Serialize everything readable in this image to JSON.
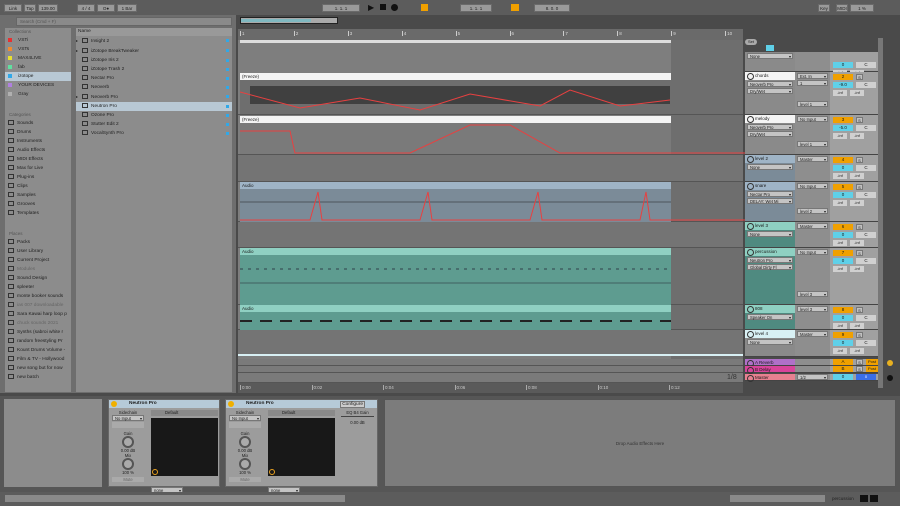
{
  "transport": {
    "link": "Link",
    "tap": "Tap",
    "tempo": "139.00",
    "signature": "4 / 4",
    "metronome": "O●",
    "quantize": "1 Bar",
    "position": "1.  1.  1",
    "position2": "1.  1.  1",
    "loop_length": "8.  0.  0",
    "key": "Key",
    "midi": "MIDI",
    "cpu": "1 %"
  },
  "browser": {
    "search_placeholder": "Search (Cmd + F)",
    "collections_header": "Collections",
    "collections": [
      {
        "label": "VSTi",
        "color": "#e83030"
      },
      {
        "label": "VSTs",
        "color": "#f08a30"
      },
      {
        "label": "MAX4LIVE",
        "color": "#e8e030"
      },
      {
        "label": "fab",
        "color": "#60e0a0"
      },
      {
        "label": "izotope",
        "color": "#30a8e8"
      },
      {
        "label": "YOUR DEVICES",
        "color": "#b080e0"
      },
      {
        "label": "Gray",
        "color": "#b0b0b0"
      }
    ],
    "categories_header": "Categories",
    "categories": [
      "Sounds",
      "Drums",
      "Instruments",
      "Audio Effects",
      "MIDI Effects",
      "Max for Live",
      "Plug-ins",
      "Clips",
      "Samples",
      "Grooves",
      "Templates"
    ],
    "places_header": "Places",
    "places": [
      "Packs",
      "User Library",
      "Current Project",
      "Modules",
      "Sound Design",
      "spleeter",
      "monte booker sounds",
      "ias 007 downloadable",
      "Sara Kawai harp loop p",
      "chuck sounds 2021",
      "Synths (sabroi white r",
      "random freestyling Pr",
      "Kount Drums Volume -",
      "Film & TV - Hollywood",
      "new song but for now",
      "new batch"
    ],
    "name_header": "Name",
    "files": [
      "Insight 2",
      "iZotope BreakTweaker",
      "iZotope Iris 2",
      "iZotope Trash 2",
      "Nectar Pro",
      "Neoverb",
      "Neoverb Pro",
      "Neutron Pro",
      "Ozone Pro",
      "Stutter Edit 2",
      "VocalSynth Pro"
    ]
  },
  "arrangement": {
    "bars": [
      "1",
      "2",
      "3",
      "4",
      "5",
      "6",
      "7",
      "8",
      "9",
      "10"
    ],
    "times": [
      "0:00",
      "0:02",
      "0:04",
      "0:06",
      "0:08",
      "0:10",
      "0:12"
    ],
    "zoom_label": "1/8",
    "freeze_label": "(Freeze)",
    "audio_label": "Audio"
  },
  "set_label": "Set",
  "tracks": [
    {
      "name": "",
      "device": "None",
      "io": "",
      "num": "",
      "vol": "0",
      "pan": "C"
    },
    {
      "name": "chords",
      "device": "Neoverb Pro",
      "param": "Dry/Wet",
      "io": "Ext. In",
      "io2": "1",
      "out": "level 1",
      "num": "2",
      "vol": "-9.0",
      "pan": "C"
    },
    {
      "name": "melody",
      "device": "Neoverb Pro",
      "param": "Dry/Wet",
      "io": "No Input",
      "out": "level 1",
      "num": "3",
      "vol": "-5.0",
      "pan": "C"
    },
    {
      "name": "level 2",
      "device": "None",
      "io": "Master",
      "num": "4",
      "vol": "0",
      "pan": "C"
    },
    {
      "name": "snare",
      "device": "Nectar Pro",
      "param": "DELAY: Wet Mi",
      "io": "No Input",
      "out": "level 2",
      "num": "5",
      "vol": "0",
      "pan": "C"
    },
    {
      "name": "level 3",
      "device": "None",
      "io": "Master",
      "num": "6",
      "vol": "0",
      "pan": "C"
    },
    {
      "name": "percussion",
      "device": "Neutron Pro",
      "param": "Global Dirty Fl",
      "io": "No Input",
      "out": "level 3",
      "num": "7",
      "vol": "0",
      "pan": "C"
    },
    {
      "name": "808",
      "device": "Speaker On",
      "io": "level 3",
      "num": "8",
      "vol": "0",
      "pan": "C"
    },
    {
      "name": "level 4",
      "device": "None",
      "io": "Master",
      "num": "9",
      "vol": "0",
      "pan": "C"
    }
  ],
  "returns": [
    {
      "name": "A Reverb",
      "num": "A",
      "post": "Post",
      "color": "#b070c8"
    },
    {
      "name": "B Delay",
      "num": "B",
      "post": "Post",
      "color": "#d8449a"
    },
    {
      "name": "Master",
      "io": "1/2",
      "num": "0",
      "vol": "0",
      "color": "#e88090"
    }
  ],
  "inf": "-inf",
  "solo": "S",
  "devices": [
    {
      "title": "Neutron Pro",
      "sidechain": "Sidechain",
      "sc_value": "No Input",
      "preset": "Default",
      "gain_label": "Gain",
      "gain": "0.00 dB",
      "mix_label": "Mix",
      "mix": "100 %",
      "mute": "Mute",
      "sel1": "none",
      "sel2": "none"
    },
    {
      "title": "Neutron Pro",
      "configure": "Configure",
      "sidechain": "Sidechain",
      "sc_value": "No Input",
      "preset": "Default",
      "gain_label": "Gain",
      "gain": "0.00 dB",
      "mix_label": "Mix",
      "mix": "100 %",
      "mute": "Mute",
      "sel1": "none",
      "sel2": "none",
      "param_name": "EQ B4 Gain",
      "param_value": "0.00 dB"
    }
  ],
  "drop_text": "Drop Audio Effects Here",
  "status": {
    "track": "percussion"
  },
  "colors": {
    "accent": "#f0a000",
    "blue": "#5fd0e8",
    "auto": "#e84040"
  }
}
